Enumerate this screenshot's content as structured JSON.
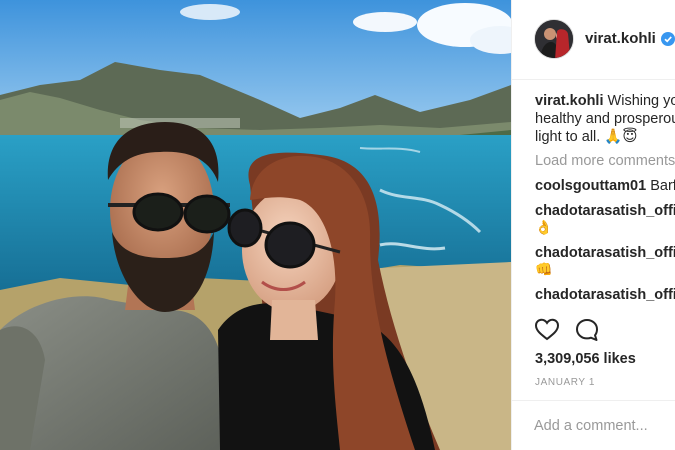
{
  "post": {
    "image_alt": "Selfie of a couple wearing sunglasses in front of the sea and mountains",
    "header": {
      "username": "virat.kohli",
      "verified_icon": "verified-badge-icon"
    },
    "caption": {
      "username": "virat.kohli",
      "line1": "Wishing yo",
      "line2": "healthy and prosperou",
      "line3": "light to all. 🙏😇"
    },
    "load_more_label": "Load more comments",
    "comments": [
      {
        "username": "coolsgouttam01",
        "text": "Barf"
      },
      {
        "username": "chadotarasatish_offic",
        "text": "👌"
      },
      {
        "username": "chadotarasatish_offic",
        "text": "👊"
      },
      {
        "username": "chadotarasatish_offic",
        "text": ""
      }
    ],
    "actions": {
      "like_icon": "heart-icon",
      "comment_icon": "comment-bubble-icon"
    },
    "likes_text": "3,309,056 likes",
    "date_text": "JANUARY 1",
    "add_comment_placeholder": "Add a comment..."
  },
  "colors": {
    "sky": "#4a9fe0",
    "sea": "#1f86b3",
    "verified_blue": "#3897f0",
    "muted_text": "#999999"
  }
}
